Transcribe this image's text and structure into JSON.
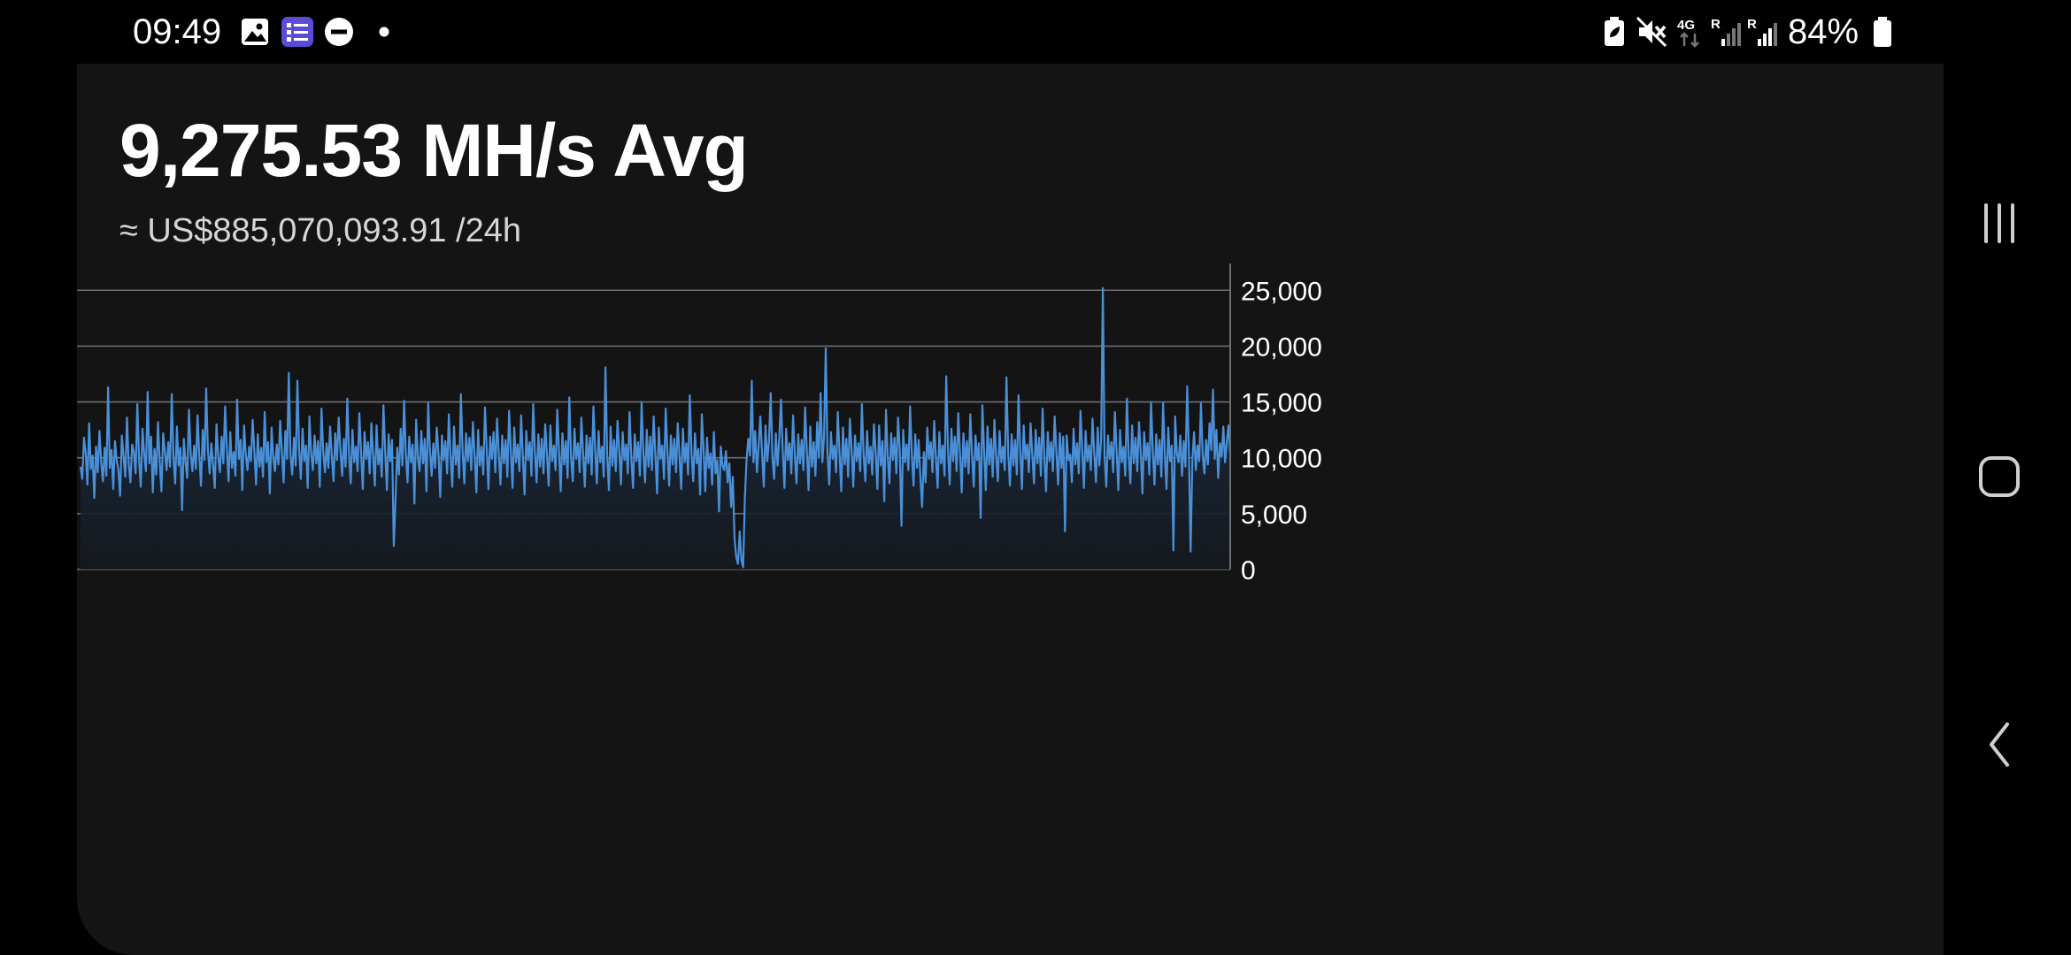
{
  "status_bar": {
    "time": "09:49",
    "battery_percent": "84%",
    "network": "4G",
    "roaming_indicator": "R",
    "left_icons": [
      "gallery-icon",
      "tasks-app-icon",
      "dnd-icon",
      "notification-dot-icon"
    ],
    "right_icons": [
      "battery-saver-icon",
      "mute-icon",
      "network-4g-icon",
      "signal-sim1-icon",
      "signal-sim2-icon",
      "battery-icon"
    ]
  },
  "hashrate": {
    "average": "9,275.53 MH/s Avg",
    "earnings": "≈ US$885,070,093.91 /24h"
  },
  "chart_data": {
    "type": "area",
    "title": "",
    "xlabel": "",
    "ylabel": "",
    "y_axis_position": "right",
    "ylim": [
      0,
      27000
    ],
    "yticks": [
      0,
      5000,
      10000,
      15000,
      20000,
      25000
    ],
    "ytick_labels": [
      "0",
      "5,000",
      "10,000",
      "15,000",
      "20,000",
      "25,000"
    ],
    "grid": true,
    "color": "#4a90d9",
    "series": [
      {
        "values": [
          9200,
          8100,
          11800,
          10400,
          7600,
          13100,
          9000,
          10200,
          6400,
          11000,
          8700,
          12400,
          9600,
          7900,
          10900,
          8400,
          16300,
          9100,
          10700,
          7200,
          11500,
          9800,
          8900,
          6600,
          12000,
          10100,
          8300,
          13600,
          9400,
          7800,
          11200,
          10500,
          8600,
          14800,
          9900,
          7400,
          12600,
          10300,
          8800,
          15900,
          9500,
          11900,
          6900,
          10800,
          8500,
          13200,
          9700,
          7000,
          12200,
          10600,
          8900,
          11400,
          9200,
          15700,
          10000,
          7700,
          12800,
          9300,
          10900,
          5300,
          11700,
          9600,
          8200,
          14300,
          10400,
          8800,
          11100,
          9000,
          13800,
          10200,
          7500,
          12500,
          9800,
          16200,
          10700,
          8600,
          11300,
          9400,
          7300,
          13000,
          10100,
          8700,
          11900,
          9500,
          14600,
          10800,
          7900,
          12300,
          9100,
          10500,
          8400,
          15200,
          9900,
          11600,
          7100,
          12900,
          10300,
          8900,
          11000,
          9700,
          13400,
          10600,
          7600,
          12100,
          9200,
          10900,
          8300,
          14100,
          9600,
          11400,
          6800,
          12700,
          10000,
          8800,
          11200,
          9400,
          13300,
          10500,
          7800,
          12400,
          9900,
          17600,
          10200,
          8500,
          11800,
          9300,
          16900,
          10800,
          8100,
          12600,
          9700,
          11100,
          7300,
          13700,
          10400,
          8900,
          12000,
          9500,
          11500,
          7400,
          14400,
          10600,
          8700,
          11300,
          9100,
          12800,
          10100,
          7900,
          12200,
          9800,
          13600,
          10700,
          8400,
          11700,
          9200,
          15300,
          10300,
          7700,
          12500,
          9600,
          11000,
          8800,
          14000,
          10500,
          7200,
          12300,
          9900,
          11400,
          8600,
          13100,
          10200,
          7500,
          12900,
          9400,
          10800,
          8300,
          14700,
          10600,
          7100,
          12100,
          9700,
          11600,
          2100,
          6200,
          10900,
          8500,
          12600,
          9300,
          15100,
          10400,
          7800,
          11900,
          9600,
          11200,
          5900,
          13400,
          10000,
          8800,
          12400,
          9500,
          11700,
          7000,
          14900,
          10700,
          8400,
          11300,
          9100,
          12700,
          10300,
          6500,
          12000,
          9800,
          11500,
          8600,
          13900,
          10100,
          7400,
          12800,
          9400,
          11100,
          8200,
          15700,
          10600,
          7700,
          12200,
          9700,
          11800,
          8900,
          13200,
          10200,
          6900,
          12500,
          9300,
          11000,
          8500,
          14500,
          10800,
          7200,
          11900,
          9900,
          12300,
          8700,
          13500,
          10400,
          7600,
          12000,
          9500,
          11600,
          8300,
          14200,
          10700,
          7300,
          12700,
          9600,
          11200,
          8800,
          13800,
          10100,
          6700,
          12400,
          9800,
          11400,
          8400,
          14800,
          10500,
          7800,
          12100,
          9200,
          11700,
          8600,
          13000,
          10300,
          7500,
          12900,
          9700,
          11100,
          8900,
          14300,
          10600,
          7000,
          12200,
          9400,
          11500,
          8200,
          15400,
          10000,
          7900,
          12600,
          9900,
          11300,
          8700,
          13600,
          10400,
          7400,
          12000,
          9500,
          11800,
          8500,
          14600,
          10800,
          7700,
          12400,
          9600,
          11000,
          8300,
          18100,
          10200,
          7100,
          12800,
          9300,
          11600,
          8800,
          13300,
          10700,
          7600,
          12300,
          9800,
          11200,
          8600,
          14100,
          10100,
          7300,
          12100,
          9700,
          11400,
          8400,
          15000,
          10500,
          7800,
          12500,
          9200,
          11900,
          8900,
          13700,
          10300,
          6800,
          12700,
          9900,
          11100,
          8100,
          14400,
          10600,
          7500,
          12000,
          9400,
          11700,
          8700,
          13100,
          10200,
          7200,
          12600,
          9600,
          11300,
          8500,
          15600,
          10400,
          7900,
          12200,
          9500,
          10800,
          6700,
          13900,
          10700,
          7000,
          11800,
          9100,
          10400,
          7600,
          12300,
          8600,
          9800,
          5200,
          11000,
          9300,
          8900,
          10600,
          7800,
          9500,
          5600,
          8300,
          2800,
          1100,
          500,
          3400,
          800,
          200,
          6400,
          9900,
          11700,
          10200,
          16900,
          9600,
          12400,
          8700,
          11100,
          13700,
          10400,
          7400,
          12900,
          9700,
          11500,
          15800,
          10100,
          8100,
          12200,
          9300,
          11800,
          15200,
          10600,
          7300,
          12600,
          9800,
          11300,
          8600,
          13800,
          10300,
          7700,
          12100,
          9500,
          11600,
          8900,
          14500,
          10700,
          7100,
          12800,
          9200,
          11400,
          8400,
          13200,
          10000,
          15800,
          9600,
          11900,
          19800,
          10500,
          7600,
          12300,
          9900,
          11100,
          8700,
          14100,
          10400,
          7000,
          12700,
          9400,
          11700,
          8300,
          13500,
          10800,
          7400,
          12000,
          9700,
          11300,
          8800,
          14800,
          10200,
          7900,
          12400,
          9500,
          11000,
          8500,
          13000,
          10600,
          7200,
          12900,
          9300,
          11500,
          6100,
          14300,
          10100,
          7700,
          12200,
          9800,
          11800,
          8600,
          13600,
          10700,
          3900,
          12500,
          9600,
          11200,
          8900,
          14600,
          10300,
          7500,
          12100,
          9100,
          11600,
          8200,
          5600,
          10500,
          7800,
          12700,
          9900,
          11400,
          8700,
          13300,
          10000,
          7300,
          12300,
          9500,
          11100,
          8400,
          17300,
          10800,
          7600,
          12600,
          9700,
          11900,
          8800,
          14000,
          10400,
          6900,
          12200,
          9200,
          11500,
          8600,
          13900,
          10200,
          7400,
          12000,
          9800,
          11300,
          4600,
          14700,
          10600,
          7100,
          12800,
          9400,
          11700,
          8300,
          13400,
          10100,
          7900,
          12400,
          9600,
          11000,
          8900,
          17200,
          10500,
          7500,
          12100,
          9300,
          11600,
          8500,
          15600,
          10700,
          7200,
          12900,
          9900,
          11200,
          8700,
          13100,
          10300,
          7700,
          12500,
          9500,
          11800,
          8400,
          14400,
          10000,
          7000,
          12300,
          9700,
          11400,
          8800,
          13700,
          10600,
          7600,
          12200,
          9100,
          11900,
          3400,
          12000,
          9800,
          10300,
          7800,
          12600,
          9400,
          11300,
          8600,
          14200,
          10800,
          7300,
          12400,
          9700,
          11100,
          8900,
          13500,
          10400,
          7800,
          12700,
          9300,
          11700,
          25200,
          10100,
          7400,
          12000,
          9900,
          11400,
          8700,
          14100,
          10600,
          7100,
          12500,
          9600,
          11000,
          8400,
          15300,
          10200,
          7700,
          12900,
          9500,
          11800,
          8800,
          13200,
          10500,
          6800,
          12300,
          9800,
          11300,
          8500,
          15000,
          10700,
          7600,
          12100,
          9400,
          11600,
          8300,
          14900,
          10300,
          7200,
          12700,
          9700,
          11100,
          1700,
          13700,
          10400,
          9600,
          12000,
          8400,
          11500,
          9200,
          16400,
          10500,
          1600,
          9800,
          12300,
          8900,
          11100,
          9700,
          14900,
          10200,
          8600,
          11600,
          9400,
          13100,
          10700,
          16100,
          9900,
          12500,
          8200,
          11300,
          10100,
          12800,
          9600,
          11400,
          12900,
          10300
        ]
      }
    ]
  },
  "nav": {
    "recent_apps": "recent-apps-icon",
    "home": "home-icon",
    "back": "back-icon"
  },
  "colors": {
    "card_background": "#141415",
    "line": "#4a90d9",
    "grid": "#6e6e70"
  }
}
